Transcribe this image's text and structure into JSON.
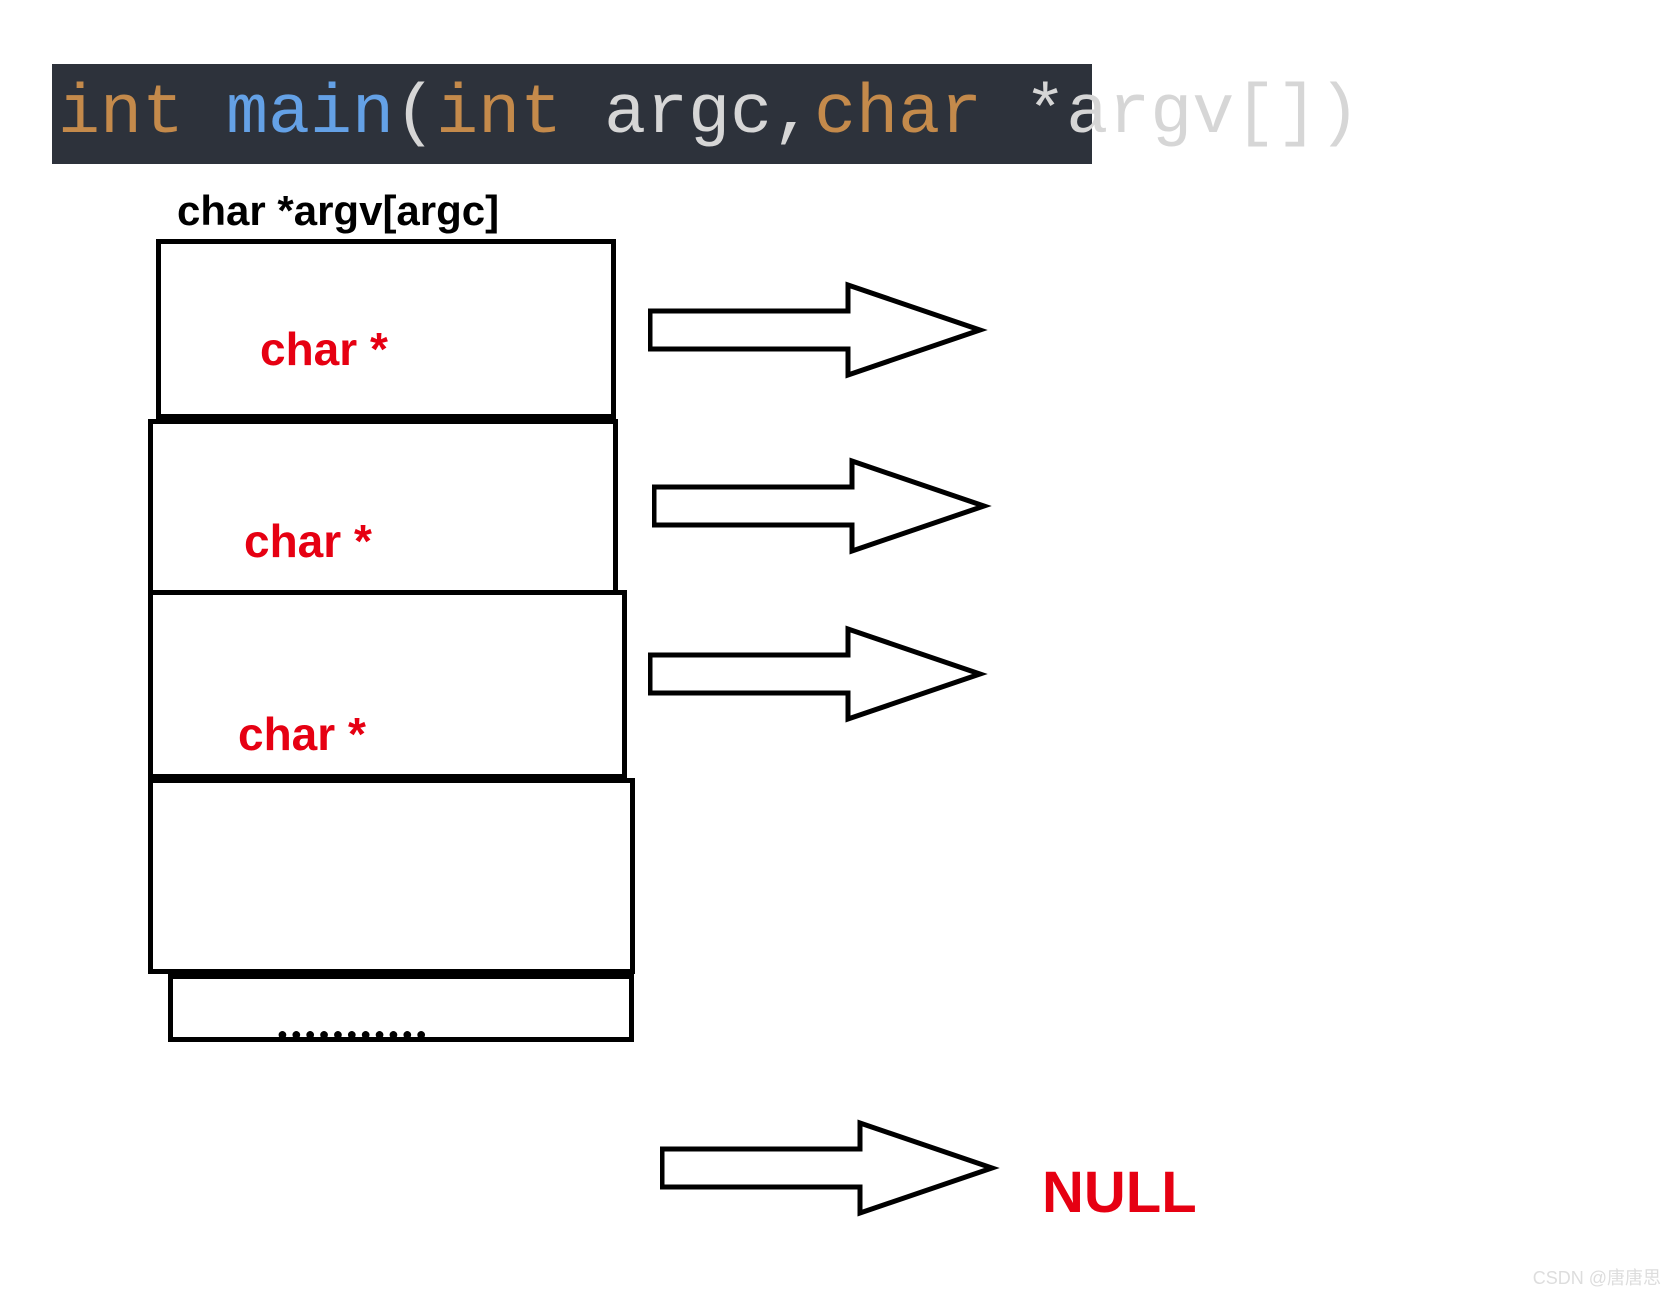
{
  "code": {
    "int": "int ",
    "main": "main",
    "paren_open": "(",
    "type1": "int ",
    "ident1": "argc",
    "comma": ",",
    "type2": "char ",
    "star": "*",
    "ident2": "argv",
    "brackets": "[]",
    "paren_close": ")"
  },
  "array": {
    "title": "char *argv[argc]",
    "cells": {
      "0": "char *",
      "1": "char *",
      "2": "char *"
    },
    "dots": "●●●●●●●●●●●",
    "terminator": "NULL"
  },
  "watermark": "CSDN @唐唐思"
}
